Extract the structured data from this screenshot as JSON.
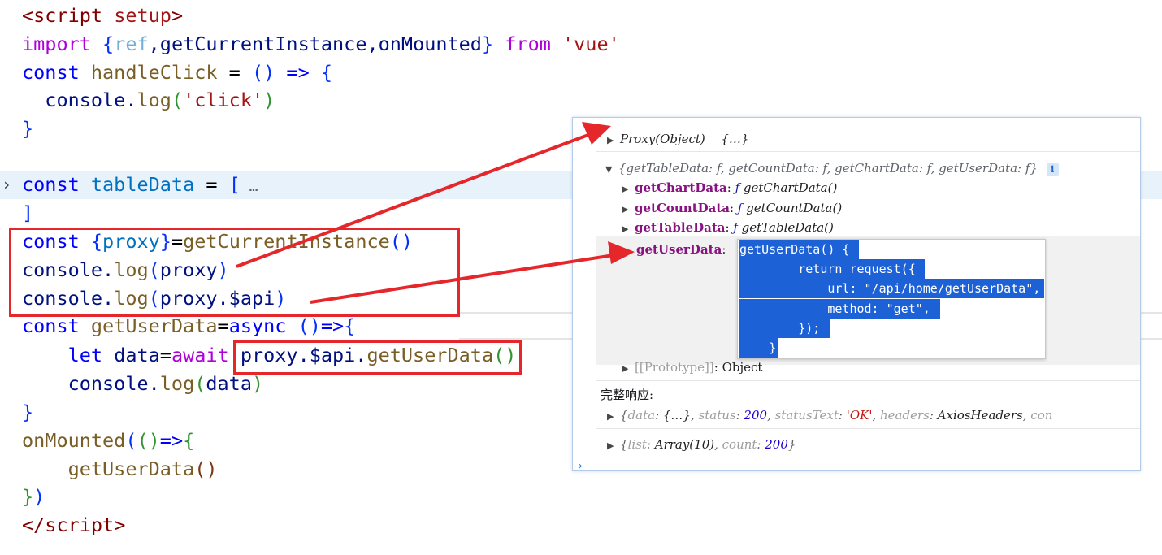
{
  "editor": {
    "lines": [
      [
        {
          "t": "<",
          "c": "tg"
        },
        {
          "t": "script",
          "c": "tg"
        },
        {
          "t": " setup",
          "c": "st"
        },
        {
          "t": ">",
          "c": "tg"
        }
      ],
      [
        {
          "t": "import ",
          "c": "kw2"
        },
        {
          "t": "{",
          "c": "b1"
        },
        {
          "t": "ref",
          "c": "dim"
        },
        {
          "t": ",getCurrentInstance,onMounted",
          "c": "vr"
        },
        {
          "t": "}",
          "c": "b1"
        },
        {
          "t": " from ",
          "c": "kw2"
        },
        {
          "t": "'vue'",
          "c": "st"
        }
      ],
      [
        {
          "t": "const ",
          "c": "kw"
        },
        {
          "t": "handleClick",
          "c": "fn"
        },
        {
          "t": " = ",
          "c": ""
        },
        {
          "t": "()",
          "c": "b1"
        },
        {
          "t": " => ",
          "c": "kw"
        },
        {
          "t": "{",
          "c": "b1"
        }
      ],
      [
        {
          "t": "  console.",
          "c": "vr"
        },
        {
          "t": "log",
          "c": "fn"
        },
        {
          "t": "(",
          "c": "b2"
        },
        {
          "t": "'click'",
          "c": "st"
        },
        {
          "t": ")",
          "c": "b2"
        }
      ],
      [
        {
          "t": "}",
          "c": "b1"
        }
      ],
      [],
      [
        {
          "t": "const ",
          "c": "kw"
        },
        {
          "t": "tableData",
          "c": "cn"
        },
        {
          "t": " = ",
          "c": ""
        },
        {
          "t": "[",
          "c": "b1"
        },
        {
          "t": " …",
          "c": "ell"
        }
      ],
      [
        {
          "t": "]",
          "c": "b1"
        }
      ],
      [
        {
          "t": "const ",
          "c": "kw"
        },
        {
          "t": "{",
          "c": "b1"
        },
        {
          "t": "proxy",
          "c": "cn"
        },
        {
          "t": "}",
          "c": "b1"
        },
        {
          "t": "=",
          "c": ""
        },
        {
          "t": "getCurrentInstance",
          "c": "fn"
        },
        {
          "t": "()",
          "c": "b1"
        }
      ],
      [
        {
          "t": "console.",
          "c": "vr"
        },
        {
          "t": "log",
          "c": "fn"
        },
        {
          "t": "(",
          "c": "b1"
        },
        {
          "t": "proxy",
          "c": "vr"
        },
        {
          "t": ")",
          "c": "b1"
        }
      ],
      [
        {
          "t": "console.",
          "c": "vr"
        },
        {
          "t": "log",
          "c": "fn"
        },
        {
          "t": "(",
          "c": "b1"
        },
        {
          "t": "proxy.$api",
          "c": "vr"
        },
        {
          "t": ")",
          "c": "b1"
        }
      ],
      [
        {
          "t": "const ",
          "c": "kw"
        },
        {
          "t": "getUserData",
          "c": "fn"
        },
        {
          "t": "=",
          "c": ""
        },
        {
          "t": "async ",
          "c": "kw"
        },
        {
          "t": "()",
          "c": "b1"
        },
        {
          "t": "=>",
          "c": "kw"
        },
        {
          "t": "{",
          "c": "b1"
        }
      ],
      [
        {
          "t": "    let ",
          "c": "kw"
        },
        {
          "t": "data",
          "c": "vr"
        },
        {
          "t": "=",
          "c": ""
        },
        {
          "t": "await ",
          "c": "kw2"
        },
        {
          "t": "proxy.$api.",
          "c": "vr"
        },
        {
          "t": "getUserData",
          "c": "fn"
        },
        {
          "t": "()",
          "c": "b2"
        }
      ],
      [
        {
          "t": "    console.",
          "c": "vr"
        },
        {
          "t": "log",
          "c": "fn"
        },
        {
          "t": "(",
          "c": "b2"
        },
        {
          "t": "data",
          "c": "vr"
        },
        {
          "t": ")",
          "c": "b2"
        }
      ],
      [
        {
          "t": "}",
          "c": "b1"
        }
      ],
      [
        {
          "t": "onMounted",
          "c": "fn"
        },
        {
          "t": "(",
          "c": "b1"
        },
        {
          "t": "()",
          "c": "b2"
        },
        {
          "t": "=>",
          "c": "kw"
        },
        {
          "t": "{",
          "c": "b2"
        }
      ],
      [
        {
          "t": "    getUserData",
          "c": "fn"
        },
        {
          "t": "()",
          "c": "b3"
        }
      ],
      [
        {
          "t": "}",
          "c": "b2"
        },
        {
          "t": ")",
          "c": "b1"
        }
      ],
      [
        {
          "t": "</",
          "c": "tg"
        },
        {
          "t": "script",
          "c": "tg"
        },
        {
          "t": ">",
          "c": "tg"
        }
      ]
    ],
    "fold_icon": "›"
  },
  "console": {
    "row1": {
      "label": "Proxy(Object)",
      "preview": "{…}"
    },
    "row2": {
      "preview": "{getTableData: f, getCountData: f, getChartData: f, getUserData: f}",
      "badge": "i"
    },
    "children": [
      {
        "key": "getChartData",
        "fn": "getChartData()"
      },
      {
        "key": "getCountData",
        "fn": "getCountData()"
      },
      {
        "key": "getTableData",
        "fn": "getTableData()"
      }
    ],
    "user_key": "getUserData",
    "proto": {
      "key": "[[Prototype]]",
      "val": "Object"
    },
    "full_response_label": "完整响应:",
    "response": {
      "parts": [
        {
          "t": "{",
          "c": "gray it"
        },
        {
          "t": "data",
          "c": "dimkey it"
        },
        {
          "t": ": ",
          "c": "gray it"
        },
        {
          "t": "{…}",
          "c": "it"
        },
        {
          "t": ", ",
          "c": "gray it"
        },
        {
          "t": "status",
          "c": "dimkey it"
        },
        {
          "t": ": ",
          "c": "gray it"
        },
        {
          "t": "200",
          "c": "num it"
        },
        {
          "t": ", ",
          "c": "gray it"
        },
        {
          "t": "statusText",
          "c": "dimkey it"
        },
        {
          "t": ": ",
          "c": "gray it"
        },
        {
          "t": "'OK'",
          "c": "strv it"
        },
        {
          "t": ", ",
          "c": "gray it"
        },
        {
          "t": "headers",
          "c": "dimkey it"
        },
        {
          "t": ": ",
          "c": "gray it"
        },
        {
          "t": "AxiosHeaders",
          "c": "it"
        },
        {
          "t": ", ",
          "c": "gray it"
        },
        {
          "t": "con",
          "c": "dimkey it"
        }
      ]
    },
    "list": {
      "parts": [
        {
          "t": "{",
          "c": "gray it"
        },
        {
          "t": "list",
          "c": "dimkey it"
        },
        {
          "t": ": ",
          "c": "gray it"
        },
        {
          "t": "Array(10)",
          "c": "it"
        },
        {
          "t": ", ",
          "c": "gray it"
        },
        {
          "t": "count",
          "c": "dimkey it"
        },
        {
          "t": ": ",
          "c": "gray it"
        },
        {
          "t": "200",
          "c": "num it"
        },
        {
          "t": "}",
          "c": "gray it"
        }
      ]
    },
    "prompt": "›"
  },
  "tooltip": {
    "lines": [
      "getUserData() {",
      "        return request({",
      "            url: \"/api/home/getUserData\",",
      "            method: \"get\",",
      "        });",
      "    }"
    ]
  },
  "colors": {
    "annotation_red": "#e5262b",
    "selection": "#1d61d6"
  }
}
